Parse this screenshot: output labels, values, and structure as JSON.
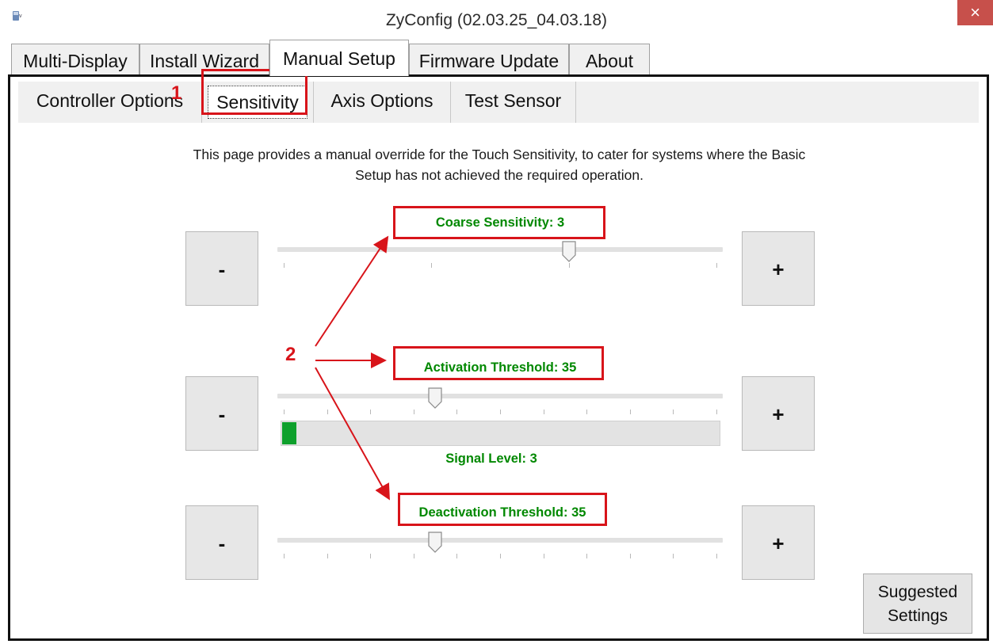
{
  "window": {
    "title": "ZyConfig (02.03.25_04.03.18)",
    "close_glyph": "×",
    "icon": "zytronic-app-icon"
  },
  "main_tabs": [
    {
      "label": "Multi-Display",
      "active": false
    },
    {
      "label": "Install Wizard",
      "active": false
    },
    {
      "label": "Manual Setup",
      "active": true
    },
    {
      "label": "Firmware Update",
      "active": false
    },
    {
      "label": "About",
      "active": false
    }
  ],
  "sub_tabs": [
    {
      "label": "Controller Options",
      "active": false
    },
    {
      "label": "Sensitivity",
      "active": true
    },
    {
      "label": "Axis Options",
      "active": false
    },
    {
      "label": "Test Sensor",
      "active": false
    }
  ],
  "description": "This page provides a manual override for the Touch Sensitivity, to cater for systems where the Basic Setup has not achieved the required operation.",
  "controls": {
    "minus_label": "-",
    "plus_label": "+",
    "coarse": {
      "label": "Coarse Sensitivity: 3",
      "value": 3,
      "position": 0.66
    },
    "activation": {
      "label": "Activation Threshold: 35",
      "value": 35,
      "position": 0.35
    },
    "signal": {
      "label": "Signal Level: 3",
      "value": 3,
      "fill_fraction": 0.033
    },
    "deactivation": {
      "label": "Deactivation Threshold: 35",
      "value": 35,
      "position": 0.35
    }
  },
  "suggested_settings_label": "Suggested Settings",
  "annotations": {
    "marker_1": "1",
    "marker_2": "2"
  },
  "colors": {
    "label_green": "#008800",
    "annotation_red": "#d8141a",
    "signal_fill": "#0ea02c",
    "close_button": "#c7504b"
  }
}
